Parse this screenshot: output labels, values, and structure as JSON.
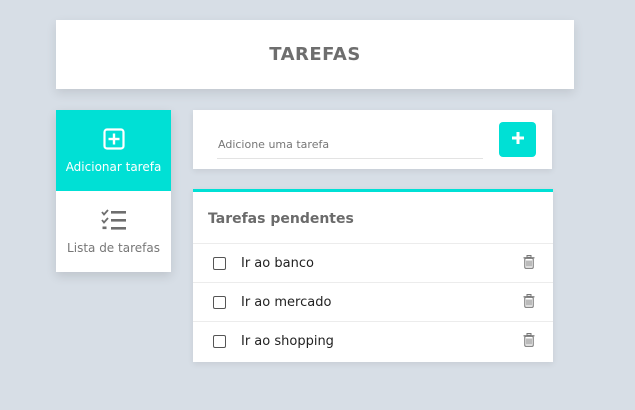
{
  "header": {
    "title": "TAREFAS"
  },
  "sidebar": {
    "items": [
      {
        "label": "Adicionar tarefa",
        "icon": "add-square-icon",
        "active": true
      },
      {
        "label": "Lista de tarefas",
        "icon": "checklist-icon",
        "active": false
      }
    ]
  },
  "add_task": {
    "placeholder": "Adicione uma tarefa",
    "button_icon": "plus-icon"
  },
  "pending": {
    "title": "Tarefas pendentes",
    "tasks": [
      {
        "label": "Ir ao banco",
        "checked": false
      },
      {
        "label": "Ir ao mercado",
        "checked": false
      },
      {
        "label": "Ir ao shopping",
        "checked": false
      }
    ]
  },
  "colors": {
    "accent": "#00e0d5",
    "background": "#d7dee6",
    "title_text": "#6e6e6e"
  }
}
